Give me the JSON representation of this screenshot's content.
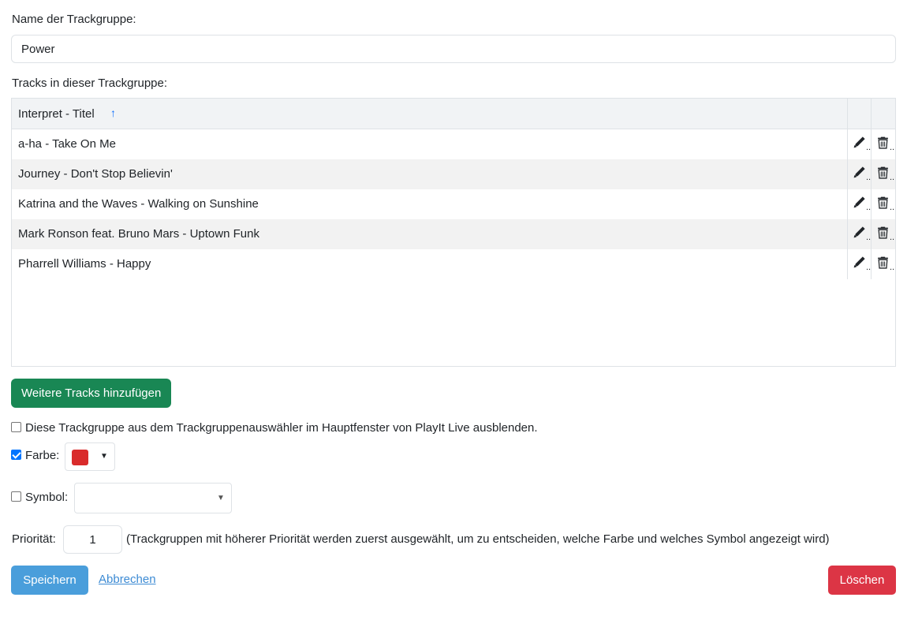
{
  "form": {
    "name_label": "Name der Trackgruppe:",
    "name_value": "Power",
    "tracks_label": "Tracks in dieser Trackgruppe:"
  },
  "table": {
    "column_header": "Interpret - Titel",
    "sort_indicator": "↑",
    "rows": [
      {
        "title": "a-ha - Take On Me"
      },
      {
        "title": "Journey - Don't Stop Believin'"
      },
      {
        "title": "Katrina and the Waves - Walking on Sunshine"
      },
      {
        "title": "Mark Ronson feat. Bruno Mars - Uptown Funk"
      },
      {
        "title": "Pharrell Williams - Happy"
      }
    ],
    "edit_icon": "pencil-icon",
    "delete_icon": "trash-icon"
  },
  "buttons": {
    "add_tracks": "Weitere Tracks hinzufügen",
    "save": "Speichern",
    "cancel": "Abbrechen",
    "delete": "Löschen"
  },
  "options": {
    "hide_label": "Diese Trackgruppe aus dem Trackgruppenauswähler im Hauptfenster von PlayIt Live ausblenden.",
    "hide_checked": false,
    "color_label": "Farbe:",
    "color_checked": true,
    "color_value": "#d92b2b",
    "symbol_label": "Symbol:",
    "symbol_checked": false,
    "symbol_value": "",
    "priority_label": "Priorität:",
    "priority_value": "1",
    "priority_hint": "(Trackgruppen mit höherer Priorität werden zuerst ausgewählt, um zu entscheiden, welche Farbe und welches Symbol angezeigt wird)"
  },
  "colors": {
    "add_button": "#198754",
    "save_button": "#4a9edb",
    "delete_button": "#dc3545",
    "link": "#3d8bd4",
    "sort_arrow": "#0d6efd"
  }
}
